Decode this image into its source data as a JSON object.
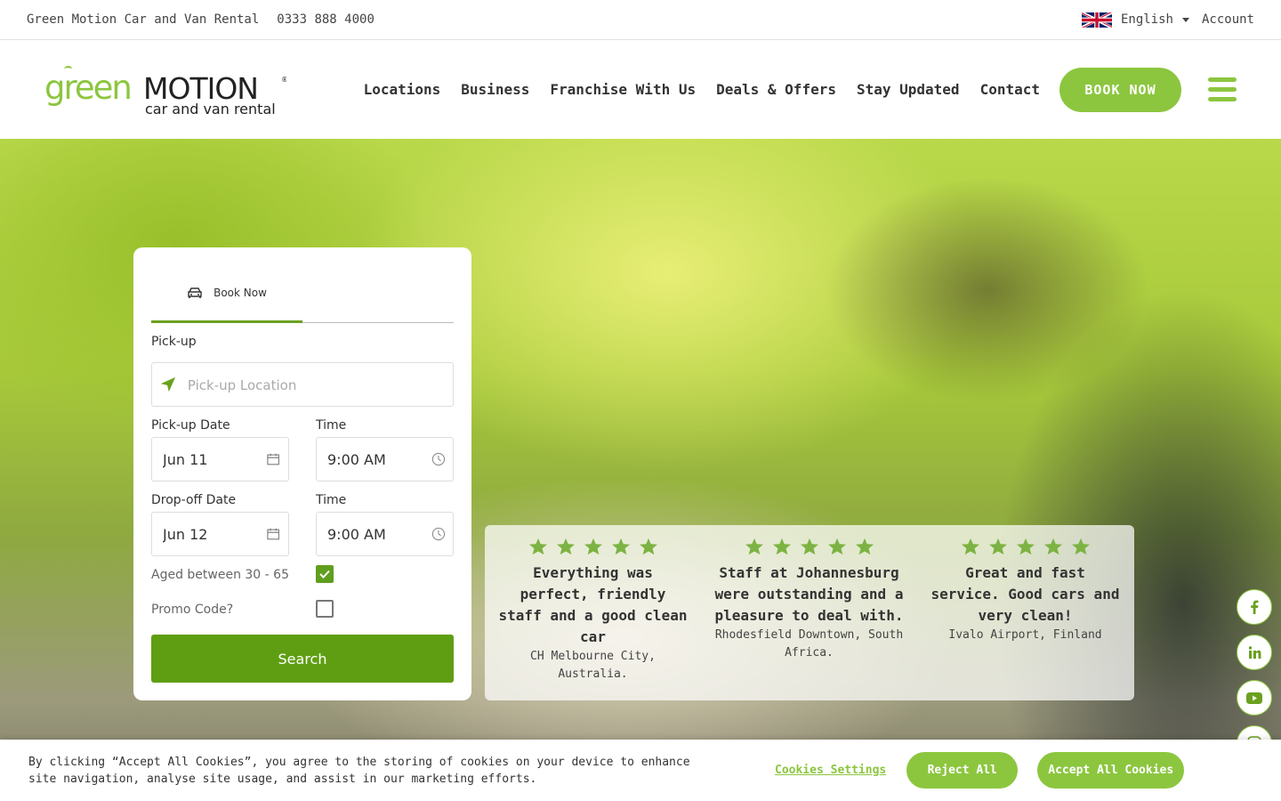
{
  "topbar": {
    "company": "Green Motion Car and Van Rental",
    "phone": "0333 888 4000",
    "language": "English",
    "account": "Account"
  },
  "header": {
    "logo_word_green": "green",
    "logo_word_motion": "MOTION",
    "logo_tagline": "car and van rental",
    "nav": [
      "Locations",
      "Business",
      "Franchise With Us",
      "Deals & Offers",
      "Stay Updated",
      "Contact"
    ],
    "book_now": "BOOK NOW"
  },
  "booking": {
    "tab_label": "Book Now",
    "pickup_label": "Pick-up",
    "pickup_placeholder": "Pick-up Location",
    "pickup_date_label": "Pick-up Date",
    "pickup_date": "Jun 11",
    "pickup_time_label": "Time",
    "pickup_time": "9:00 AM",
    "dropoff_date_label": "Drop-off Date",
    "dropoff_date": "Jun 12",
    "dropoff_time_label": "Time",
    "dropoff_time": "9:00 AM",
    "age_label": "Aged between 30 - 65",
    "age_checked": true,
    "promo_label": "Promo Code?",
    "promo_checked": false,
    "search": "Search"
  },
  "reviews": [
    {
      "stars": 5,
      "text": "Everything was perfect, friendly staff and a good clean car",
      "location": "CH Melbourne City, Australia."
    },
    {
      "stars": 5,
      "text": "Staff at Johannesburg were outstanding and a pleasure to deal with.",
      "location": "Rhodesfield Downtown, South Africa."
    },
    {
      "stars": 5,
      "text": "Great and fast service. Good cars and very clean!",
      "location": "Ivalo Airport, Finland"
    }
  ],
  "social": [
    "facebook-icon",
    "linkedin-icon",
    "youtube-icon",
    "instagram-icon"
  ],
  "cookie": {
    "message": "By clicking “Accept All Cookies”, you agree to the storing of cookies on your device to enhance site navigation, analyse site usage, and assist in our marketing efforts.",
    "settings": "Cookies Settings",
    "reject": "Reject All",
    "accept": "Accept All Cookies"
  },
  "colors": {
    "brand_green": "#8cc63f",
    "button_green": "#5f9e12",
    "text": "#333333"
  }
}
